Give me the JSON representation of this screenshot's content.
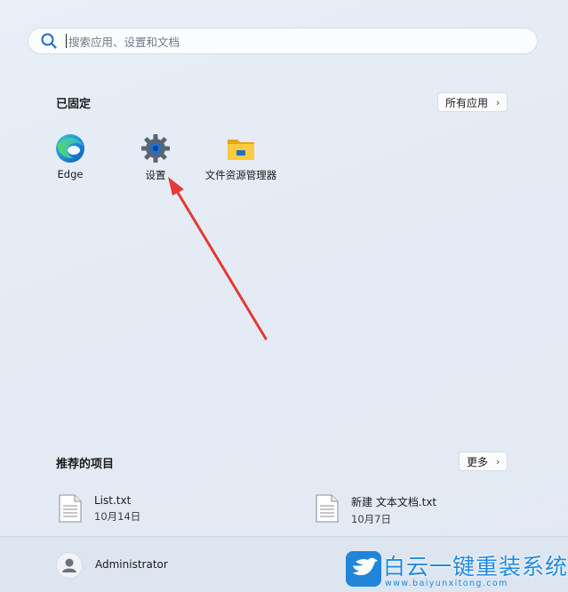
{
  "search": {
    "placeholder": "搜索应用、设置和文档"
  },
  "pinned": {
    "title": "已固定",
    "all_apps_label": "所有应用",
    "apps": [
      {
        "label": "Edge",
        "icon": "edge-icon"
      },
      {
        "label": "设置",
        "icon": "settings-gear-icon"
      },
      {
        "label": "文件资源管理器",
        "icon": "folder-icon"
      }
    ]
  },
  "recommended": {
    "title": "推荐的项目",
    "more_label": "更多",
    "items": [
      {
        "name": "List.txt",
        "date": "10月14日"
      },
      {
        "name": "新建 文本文档.txt",
        "date": "10月7日"
      }
    ]
  },
  "user": {
    "name": "Administrator"
  },
  "watermark": {
    "brand": "白云一键重装系统",
    "url": "www.baiyunxitong.com"
  },
  "colors": {
    "accent": "#1e8ae0",
    "arrow": "#e53935"
  }
}
